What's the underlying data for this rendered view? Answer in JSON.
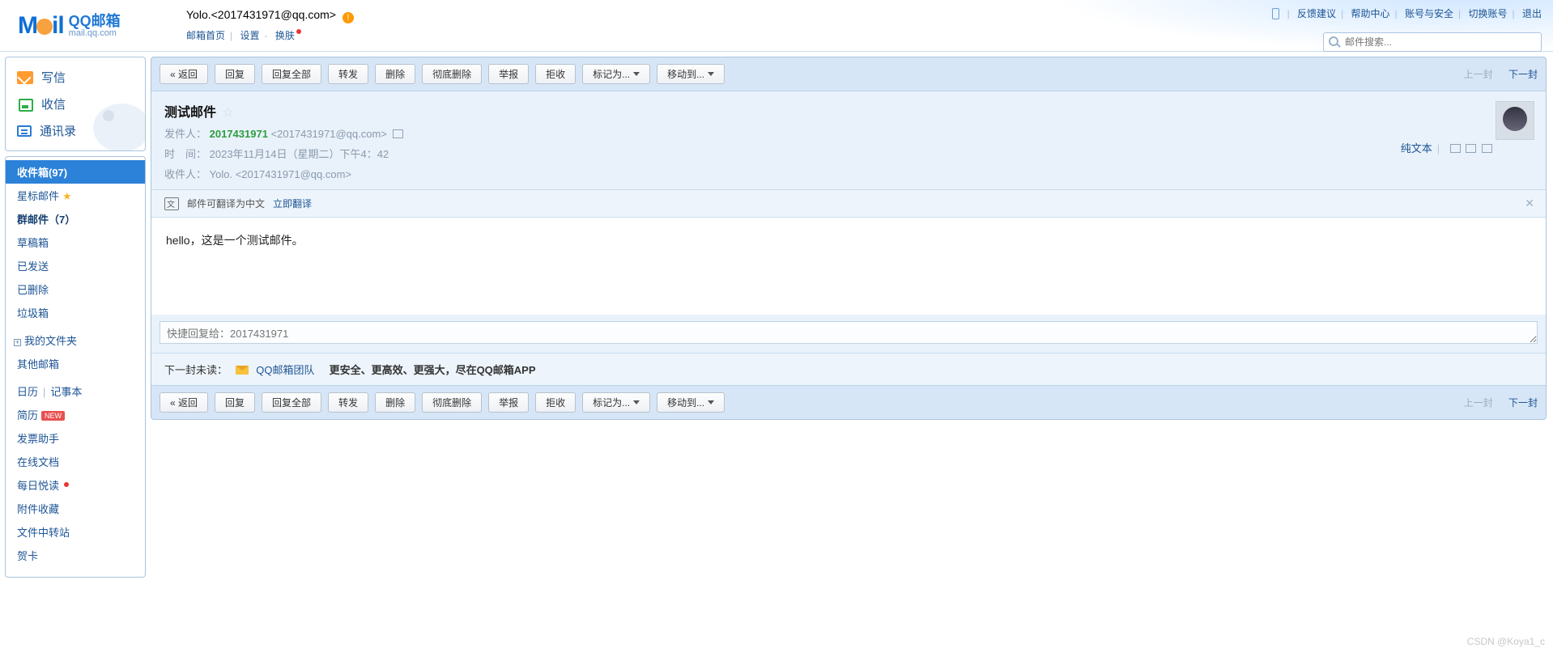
{
  "header": {
    "logo_cn": "QQ邮箱",
    "logo_en": "mail.qq.com",
    "user_display": "Yolo.<2017431971@qq.com>",
    "home": "邮箱首页",
    "settings": "设置",
    "skin": "换肤"
  },
  "top_nav": {
    "feedback": "反馈建议",
    "help": "帮助中心",
    "account": "账号与安全",
    "switch": "切换账号",
    "logout": "退出"
  },
  "search": {
    "placeholder": "邮件搜索..."
  },
  "side_main": {
    "compose": "写信",
    "receive": "收信",
    "contacts": "通讯录"
  },
  "folders": {
    "inbox": "收件箱(97)",
    "starred": "星标邮件",
    "group": "群邮件（7）",
    "drafts": "草稿箱",
    "sent": "已发送",
    "deleted": "已删除",
    "junk": "垃圾箱",
    "my_folders": "我的文件夹",
    "other_mail": "其他邮箱",
    "calendar": "日历",
    "notes": "记事本",
    "resume": "简历",
    "invoice": "发票助手",
    "docs": "在线文档",
    "daily": "每日悦读",
    "attachments": "附件收藏",
    "transfer": "文件中转站",
    "cards": "贺卡",
    "new_badge": "NEW"
  },
  "toolbar": {
    "back": "« 返回",
    "reply": "回复",
    "reply_all": "回复全部",
    "forward": "转发",
    "delete": "删除",
    "delete_forever": "彻底删除",
    "report": "举报",
    "reject": "拒收",
    "mark_as": "标记为...",
    "move_to": "移动到...",
    "prev": "上一封",
    "next": "下一封"
  },
  "mail": {
    "subject": "测试邮件",
    "from_label": "发件人：",
    "from_name": "2017431971",
    "from_addr": "<2017431971@qq.com>",
    "time_label": "时　间：",
    "time_value": "2023年11月14日（星期二）下午4：42",
    "to_label": "收件人：",
    "to_value": "Yolo. <2017431971@qq.com>",
    "plain_text": "纯文本",
    "body": "hello，这是一个测试邮件。"
  },
  "translate": {
    "hint": "邮件可翻译为中文",
    "action": "立即翻译"
  },
  "quick_reply": {
    "placeholder": "快捷回复给：2017431971"
  },
  "next_unread": {
    "lead": "下一封未读：",
    "sender": "QQ邮箱团队",
    "subject": "更安全、更高效、更强大，尽在QQ邮箱APP"
  },
  "watermark": "CSDN @Koya1_c"
}
